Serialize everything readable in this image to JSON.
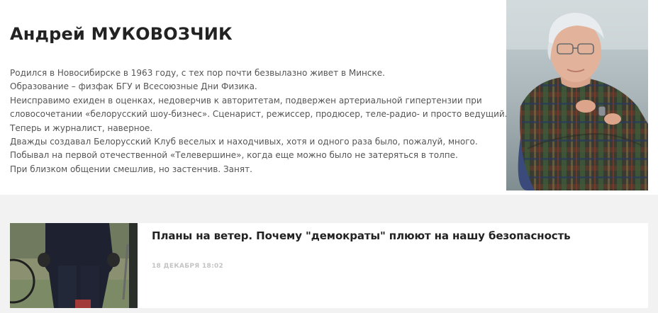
{
  "author": {
    "name": "Андрей МУКОВОЗЧИК",
    "bio_lines": [
      "Родился в Новосибирске в 1963 году, с тех пор почти безвылазно живет в Минске.",
      "Образование – физфак БГУ и Всесоюзные Дни Физика.",
      "Неисправимо exиден в оценках, недоверчив к авторитетам, подвержен артериальной гипертензии при",
      "словосочетании «белорусский шоу-бизнес». Сценарист, режиссер, продюсер, теле-радио- и просто ведущий.",
      "Теперь и журналист, наверное.",
      "Дважды создавал Белорусский Клуб веселых и находчивых, хотя и одного раза было, пожалуй, много.",
      "Побывал на первой отечественной «Телевершине», когда еще можно было не затеряться в толпе.",
      "При близком общении смешлив, но застенчив. Занят."
    ]
  },
  "articles": [
    {
      "title": "Планы на ветер. Почему \"демократы\" плюют на нашу безопасность",
      "date": "18 декабря 18:02"
    }
  ],
  "colors": {
    "page_background": "#f2f2f2",
    "card_background": "#ffffff",
    "heading": "#222222",
    "body_text": "#555555",
    "date_text": "#c4c4c4"
  }
}
